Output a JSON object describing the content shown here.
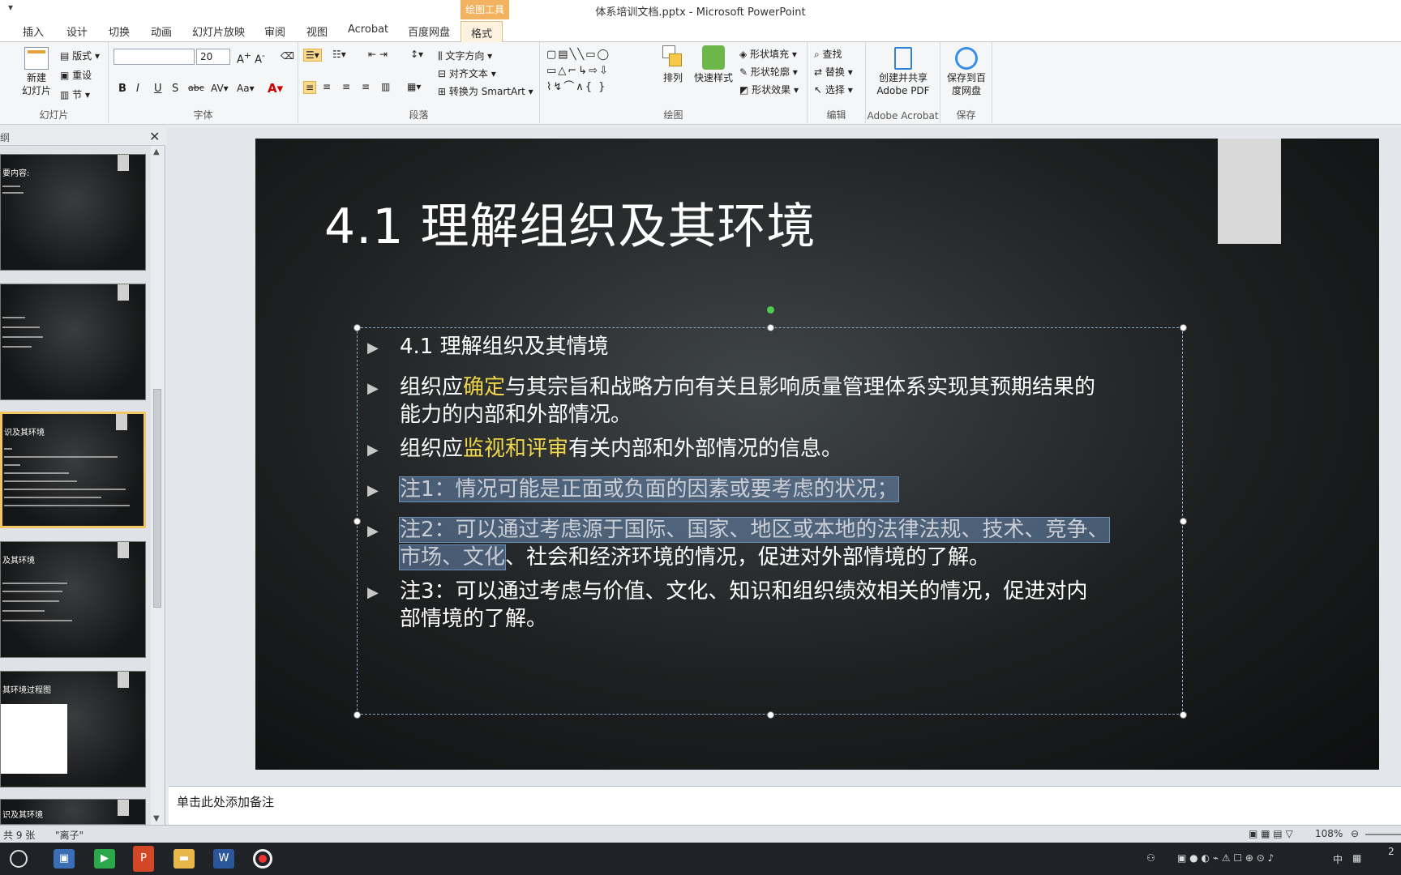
{
  "window": {
    "title": "体系培训文档.pptx - Microsoft PowerPoint",
    "context_group": "绘图工具"
  },
  "tabs": [
    "插入",
    "设计",
    "切换",
    "动画",
    "幻灯片放映",
    "审阅",
    "视图",
    "Acrobat",
    "百度网盘",
    "格式"
  ],
  "ribbon": {
    "slides_group": {
      "new_slide": "新建\n幻灯片",
      "layout": "版式",
      "reset": "重设",
      "section": "节",
      "label": "幻灯片"
    },
    "font_group": {
      "font_name": "",
      "font_size": "20",
      "label": "字体"
    },
    "paragraph_group": {
      "text_direction": "文字方向",
      "align_text": "对齐文本",
      "convert_smartart": "转换为 SmartArt",
      "label": "段落"
    },
    "drawing_group": {
      "arrange": "排列",
      "quick_styles": "快速样式",
      "shape_fill": "形状填充",
      "shape_outline": "形状轮廓",
      "shape_effects": "形状效果",
      "label": "绘图"
    },
    "editing_group": {
      "find": "查找",
      "replace": "替换",
      "select": "选择",
      "label": "编辑"
    },
    "acrobat_group": {
      "create_share": "创建并共享\nAdobe PDF",
      "label": "Adobe Acrobat"
    },
    "save_group": {
      "save_baidu": "保存到百\n度网盘",
      "label": "保存"
    }
  },
  "panel": {
    "tab_stub": "纲",
    "thumbnails": [
      {
        "title": "要内容:"
      },
      {
        "title": ""
      },
      {
        "title": "识及其环境"
      },
      {
        "title": "及其环境"
      },
      {
        "title": "其环境过程图"
      },
      {
        "title": "识及其环境"
      }
    ]
  },
  "slide": {
    "title": "4.1 理解组织及其环境",
    "p1": "4.1 理解组织及其情境",
    "p2_a": "组织应",
    "p2_hl": "确定",
    "p2_b": "与其宗旨和战略方向有关且影响质量管理体系实现其预期结果的",
    "p2_c": "能力的内部和外部情况。",
    "p3_a": "组织应",
    "p3_hl": "监视和评审",
    "p3_b": "有关内部和外部情况的信息。",
    "p4": "注1：情况可能是正面或负面的因素或要考虑的状况；",
    "p5_a": "注2：可以通过考虑源于国际、国家、地区或本地的法律法规、技术、竞争、",
    "p5_b": "市场、文化",
    "p5_c": "、社会和经济环境的情况，促进对外部情境的了解。",
    "p6_a": "注3：可以通过考虑与价值、文化、知识和组织绩效相关的情况，促进对内",
    "p6_b": "部情境的了解。"
  },
  "notes": {
    "placeholder": "单击此处添加备注"
  },
  "status": {
    "slide_count": "共 9 张",
    "theme": "\"离子\"",
    "zoom": "108%"
  },
  "tray": {
    "ime": "中",
    "clock": "2"
  }
}
